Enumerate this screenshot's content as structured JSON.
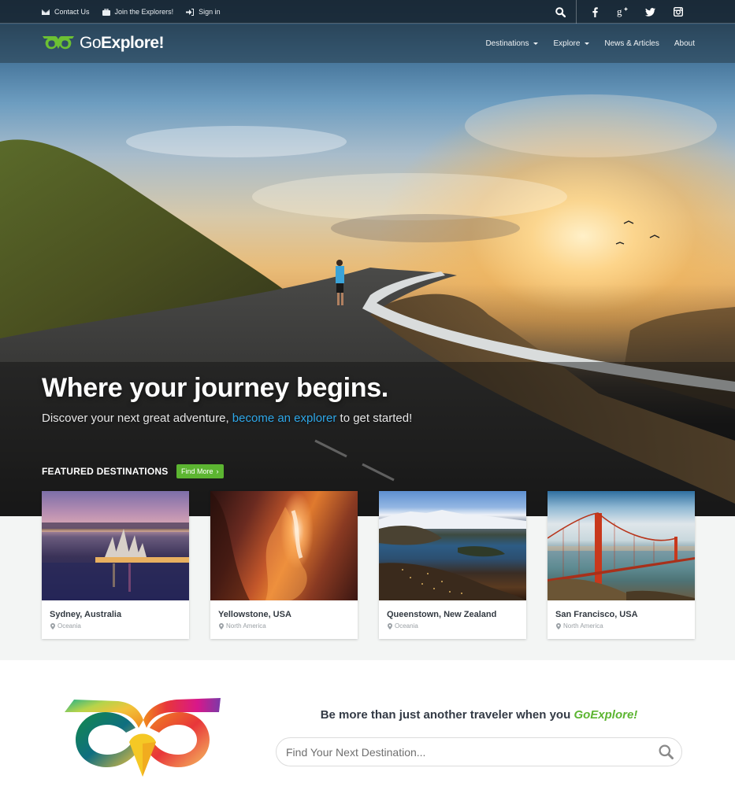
{
  "topbar": {
    "links": [
      {
        "icon": "envelope-icon",
        "label": "Contact Us"
      },
      {
        "icon": "briefcase-icon",
        "label": "Join the Explorers!"
      },
      {
        "icon": "sign-in-icon",
        "label": "Sign in"
      }
    ],
    "search_icon": "search-icon",
    "social": [
      {
        "icon": "facebook-icon",
        "glyph": "f"
      },
      {
        "icon": "google-plus-icon",
        "glyph": "g+"
      },
      {
        "icon": "twitter-icon",
        "glyph": "t"
      },
      {
        "icon": "instagram-icon",
        "glyph": "ig"
      }
    ]
  },
  "nav": {
    "brand_go": "Go",
    "brand_explore": "Explore!",
    "items": [
      {
        "label": "Destinations",
        "dropdown": true
      },
      {
        "label": "Explore",
        "dropdown": true
      },
      {
        "label": "News & Articles",
        "dropdown": false
      },
      {
        "label": "About",
        "dropdown": false
      }
    ]
  },
  "hero": {
    "headline": "Where your journey begins.",
    "sub_before": "Discover your next great adventure, ",
    "sub_link": "become an explorer",
    "sub_after": " to get started!"
  },
  "featured": {
    "title": "FEATURED DESTINATIONS",
    "find_more": "Find More",
    "find_more_chevron": "›",
    "cards": [
      {
        "title": "Sydney, Australia",
        "region": "Oceania",
        "image": "sydney-opera-house"
      },
      {
        "title": "Yellowstone, USA",
        "region": "North America",
        "image": "antelope-canyon"
      },
      {
        "title": "Queenstown, New Zealand",
        "region": "Oceania",
        "image": "queenstown-lake"
      },
      {
        "title": "San Francisco, USA",
        "region": "North America",
        "image": "golden-gate-bridge"
      }
    ]
  },
  "cta": {
    "tagline_before": "Be more than just another traveler when you ",
    "tagline_brand": "GoExplore!",
    "search_placeholder": "Find Your Next Destination..."
  },
  "colors": {
    "brand_green": "#5cb531",
    "link_blue": "#2ea7e8",
    "band_bg": "#f3f5f4"
  }
}
